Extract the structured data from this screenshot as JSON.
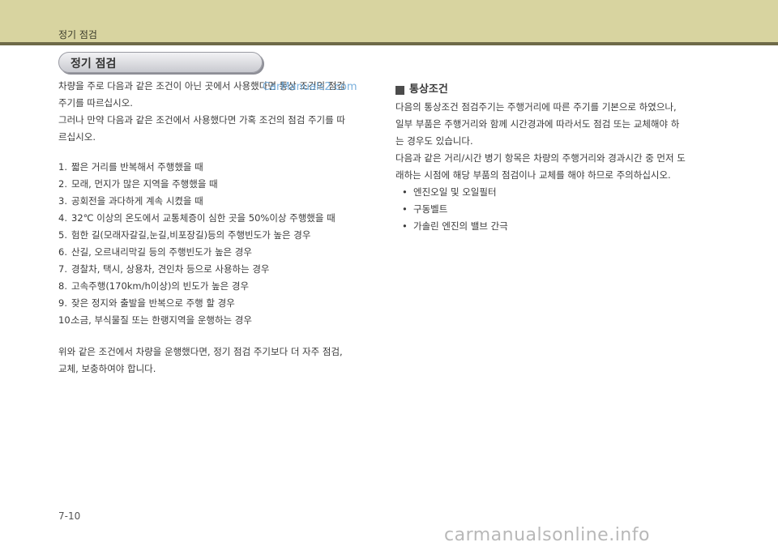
{
  "header": {
    "title": "정기 점검"
  },
  "section_title": "정기 점검",
  "left": {
    "intro": [
      "차량을 주로 다음과 같은 조건이 아닌 곳에서 사용했다면 통상 조건의 점검",
      "주기를 따르십시오.",
      "그러나 만약 다음과 같은 조건에서 사용했다면 가혹 조건의 점검 주기를 따",
      "르십시오."
    ],
    "list": [
      {
        "n": "1.",
        "text": "짧은 거리를 반복해서 주행했을 때"
      },
      {
        "n": "2.",
        "text": "모래, 먼지가 많은 지역을 주행했을 때"
      },
      {
        "n": "3.",
        "text": "공회전을 과다하게 계속 시켰을 때"
      },
      {
        "n": "4.",
        "text": "32℃ 이상의 온도에서 교통체증이 심한 곳을 50%이상 주행했을 때"
      },
      {
        "n": "5.",
        "text": "험한 길(모래자갈길,눈길,비포장길)등의 주행빈도가 높은 경우"
      },
      {
        "n": "6.",
        "text": "산길, 오르내리막길 등의 주행빈도가 높은 경우"
      },
      {
        "n": "7.",
        "text": "경찰차, 택시, 상용차, 견인차 등으로 사용하는 경우"
      },
      {
        "n": "8.",
        "text": "고속주행(170km/h이상)의 빈도가 높은 경우"
      },
      {
        "n": "9.",
        "text": "잦은 정지와 출발을 반복으로 주행 할 경우"
      },
      {
        "n": "10.",
        "text": "소금, 부식물질 또는 한랭지역을 운행하는 경우"
      }
    ],
    "outro": [
      "위와 같은 조건에서 차량을 운행했다면, 정기 점검 주기보다 더 자주 점검,",
      "교체, 보충하여야 합니다."
    ]
  },
  "right": {
    "heading": "통상조건",
    "paragraph": [
      "다음의 통상조건 점검주기는 주행거리에 따른 주기를 기본으로 하였으나,",
      "일부 부품은 주행거리와 함께 시간경과에 따라서도 점검 또는 교체해야 하",
      "는 경우도 있습니다.",
      "다음과 같은 거리/시간 병기 항목은 차량의 주행거리와 경과시간 중 먼저 도",
      "래하는 시점에 해당 부품의 점검이나 교체를 해야 하므로 주의하십시오."
    ],
    "bullets": [
      "엔진오일 및 오일필터",
      "구동벨트",
      "가솔린 엔진의 밸브 간극"
    ]
  },
  "page_number": "7-10",
  "watermark_top": "CarManuals2.com",
  "watermark_footer": "carmanualsonline.info"
}
